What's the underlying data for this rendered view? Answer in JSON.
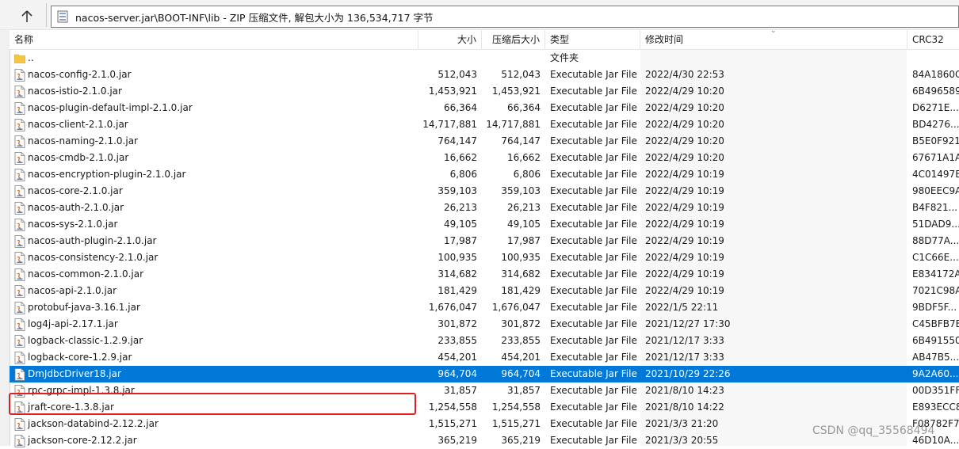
{
  "address": {
    "text": "nacos-server.jar\\BOOT-INF\\lib - ZIP 压缩文件, 解包大小为 136,534,717 字节"
  },
  "columns": {
    "name": "名称",
    "size": "大小",
    "compressed": "压缩后大小",
    "type": "类型",
    "modified": "修改时间",
    "crc": "CRC32"
  },
  "parent": {
    "name": "..",
    "type": "文件夹"
  },
  "rows": [
    {
      "name": "nacos-config-2.1.0.jar",
      "size": "512,043",
      "csize": "512,043",
      "type": "Executable Jar File",
      "time": "2022/4/30 22:53",
      "crc": "84A1860C"
    },
    {
      "name": "nacos-istio-2.1.0.jar",
      "size": "1,453,921",
      "csize": "1,453,921",
      "type": "Executable Jar File",
      "time": "2022/4/29 10:20",
      "crc": "6B496589"
    },
    {
      "name": "nacos-plugin-default-impl-2.1.0.jar",
      "size": "66,364",
      "csize": "66,364",
      "type": "Executable Jar File",
      "time": "2022/4/29 10:20",
      "crc": "D6271E..."
    },
    {
      "name": "nacos-client-2.1.0.jar",
      "size": "14,717,881",
      "csize": "14,717,881",
      "type": "Executable Jar File",
      "time": "2022/4/29 10:20",
      "crc": "BD4276..."
    },
    {
      "name": "nacos-naming-2.1.0.jar",
      "size": "764,147",
      "csize": "764,147",
      "type": "Executable Jar File",
      "time": "2022/4/29 10:20",
      "crc": "B5E0F921"
    },
    {
      "name": "nacos-cmdb-2.1.0.jar",
      "size": "16,662",
      "csize": "16,662",
      "type": "Executable Jar File",
      "time": "2022/4/29 10:20",
      "crc": "67671A1A"
    },
    {
      "name": "nacos-encryption-plugin-2.1.0.jar",
      "size": "6,806",
      "csize": "6,806",
      "type": "Executable Jar File",
      "time": "2022/4/29 10:19",
      "crc": "4C01497E"
    },
    {
      "name": "nacos-core-2.1.0.jar",
      "size": "359,103",
      "csize": "359,103",
      "type": "Executable Jar File",
      "time": "2022/4/29 10:19",
      "crc": "980EEC9A"
    },
    {
      "name": "nacos-auth-2.1.0.jar",
      "size": "26,213",
      "csize": "26,213",
      "type": "Executable Jar File",
      "time": "2022/4/29 10:19",
      "crc": "B4F821..."
    },
    {
      "name": "nacos-sys-2.1.0.jar",
      "size": "49,105",
      "csize": "49,105",
      "type": "Executable Jar File",
      "time": "2022/4/29 10:19",
      "crc": "51DAD9..."
    },
    {
      "name": "nacos-auth-plugin-2.1.0.jar",
      "size": "17,987",
      "csize": "17,987",
      "type": "Executable Jar File",
      "time": "2022/4/29 10:19",
      "crc": "88D77A..."
    },
    {
      "name": "nacos-consistency-2.1.0.jar",
      "size": "100,935",
      "csize": "100,935",
      "type": "Executable Jar File",
      "time": "2022/4/29 10:19",
      "crc": "C1C66E..."
    },
    {
      "name": "nacos-common-2.1.0.jar",
      "size": "314,682",
      "csize": "314,682",
      "type": "Executable Jar File",
      "time": "2022/4/29 10:19",
      "crc": "E834172A"
    },
    {
      "name": "nacos-api-2.1.0.jar",
      "size": "181,429",
      "csize": "181,429",
      "type": "Executable Jar File",
      "time": "2022/4/29 10:19",
      "crc": "7021C98A"
    },
    {
      "name": "protobuf-java-3.16.1.jar",
      "size": "1,676,047",
      "csize": "1,676,047",
      "type": "Executable Jar File",
      "time": "2022/1/5 22:11",
      "crc": "9BDF5F..."
    },
    {
      "name": "log4j-api-2.17.1.jar",
      "size": "301,872",
      "csize": "301,872",
      "type": "Executable Jar File",
      "time": "2021/12/27 17:30",
      "crc": "C45BFB7E"
    },
    {
      "name": "logback-classic-1.2.9.jar",
      "size": "233,855",
      "csize": "233,855",
      "type": "Executable Jar File",
      "time": "2021/12/17 3:33",
      "crc": "6B491550"
    },
    {
      "name": "logback-core-1.2.9.jar",
      "size": "454,201",
      "csize": "454,201",
      "type": "Executable Jar File",
      "time": "2021/12/17 3:33",
      "crc": "AB47B5..."
    },
    {
      "name": "DmJdbcDriver18.jar",
      "size": "964,704",
      "csize": "964,704",
      "type": "Executable Jar File",
      "time": "2021/10/29 22:26",
      "crc": "9A2A60...",
      "selected": true
    },
    {
      "name": "rpc-grpc-impl-1.3.8.jar",
      "size": "31,857",
      "csize": "31,857",
      "type": "Executable Jar File",
      "time": "2021/8/10 14:23",
      "crc": "00D351FF"
    },
    {
      "name": "jraft-core-1.3.8.jar",
      "size": "1,254,558",
      "csize": "1,254,558",
      "type": "Executable Jar File",
      "time": "2021/8/10 14:22",
      "crc": "E893ECC8"
    },
    {
      "name": "jackson-databind-2.12.2.jar",
      "size": "1,515,271",
      "csize": "1,515,271",
      "type": "Executable Jar File",
      "time": "2021/3/3 21:20",
      "crc": "F08782F7"
    },
    {
      "name": "jackson-core-2.12.2.jar",
      "size": "365,219",
      "csize": "365,219",
      "type": "Executable Jar File",
      "time": "2021/3/3 20:55",
      "crc": "46D10A..."
    }
  ],
  "watermark": "CSDN @qq_35568494",
  "colors": {
    "selection": "#0078d7",
    "highlight_border": "#e02020"
  }
}
